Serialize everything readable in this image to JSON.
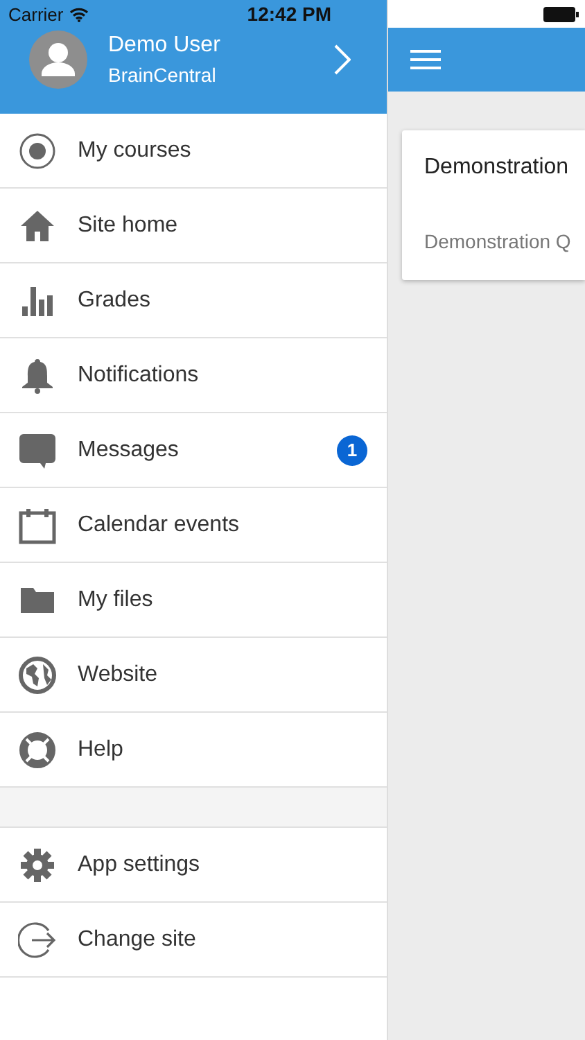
{
  "status_bar": {
    "carrier": "Carrier",
    "time": "12:42 PM"
  },
  "user": {
    "name": "Demo User",
    "site": "BrainCentral"
  },
  "menu": [
    {
      "label": "My courses"
    },
    {
      "label": "Site home"
    },
    {
      "label": "Grades"
    },
    {
      "label": "Notifications"
    },
    {
      "label": "Messages",
      "badge": "1"
    },
    {
      "label": "Calendar events"
    },
    {
      "label": "My files"
    },
    {
      "label": "Website"
    },
    {
      "label": "Help"
    }
  ],
  "footer_menu": [
    {
      "label": "App settings"
    },
    {
      "label": "Change site"
    }
  ],
  "card": {
    "title": "Demonstration",
    "subtitle": "Demonstration Q"
  }
}
